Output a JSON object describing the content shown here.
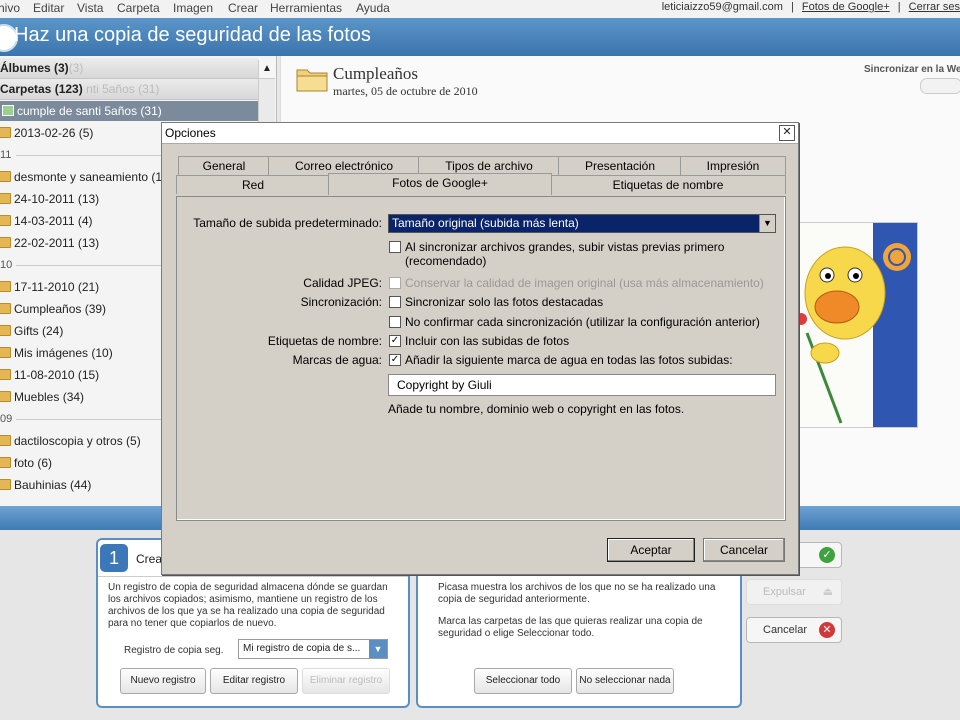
{
  "menubar": {
    "items": [
      "hivo",
      "Editar",
      "Vista",
      "Carpeta",
      "Imagen",
      "Crear",
      "Herramientas",
      "Ayuda"
    ],
    "user_email": "leticiaizzo59@gmail.com",
    "google_photos_link": "Fotos de Google+",
    "logout_link": "Cerrar ses",
    "sep": "|"
  },
  "title": "Haz una copia de seguridad de las fotos",
  "left_panel": {
    "albums": "Álbumes (3)",
    "albums_ghost": "(3)",
    "folders": "Carpetas (123)",
    "folders_ghost": "nti 5años (31)",
    "selected": "cumple de santi 5años (31)",
    "rows": [
      {
        "type": "item",
        "label": "2013-02-26 (5)"
      },
      {
        "type": "year",
        "label": "11"
      },
      {
        "type": "item",
        "label": "desmonte y saneamiento (1"
      },
      {
        "type": "item",
        "label": "24-10-2011 (13)"
      },
      {
        "type": "item",
        "label": "14-03-2011 (4)"
      },
      {
        "type": "item",
        "label": "22-02-2011 (13)"
      },
      {
        "type": "year",
        "label": "10"
      },
      {
        "type": "item",
        "label": "17-11-2010 (21)"
      },
      {
        "type": "item",
        "label": "Cumpleaños (39)"
      },
      {
        "type": "item",
        "label": "Gifts (24)"
      },
      {
        "type": "item",
        "label": "Mis imágenes (10)"
      },
      {
        "type": "item",
        "label": "11-08-2010 (15)"
      },
      {
        "type": "item",
        "label": "Muebles (34)"
      },
      {
        "type": "year",
        "label": "09"
      },
      {
        "type": "item",
        "label": "dactiloscopia y otros (5)"
      },
      {
        "type": "item",
        "label": "foto (6)"
      },
      {
        "type": "item",
        "label": "Bauhinias (44)"
      }
    ]
  },
  "main": {
    "folder_title": "Cumpleaños",
    "folder_date": "martes, 05 de octubre de 2010",
    "sync_web": "Sincronizar en la Web"
  },
  "bottom": {
    "step1_number": "1",
    "step1_title": "Crea",
    "step1_desc": "Un registro de copia de seguridad almacena dónde se guardan los archivos copiados; asimismo, mantiene un registro de los archivos de los que ya se ha realizado una copia de seguridad para no tener que copiarlos de nuevo.",
    "backup_log_label": "Registro de copia seg.",
    "backup_log_value": "Mi registro de copia de s...",
    "new_log": "Nuevo registro",
    "edit_log": "Editar registro",
    "delete_log": "Eliminar registro",
    "step2_desc1": "Picasa muestra los archivos de los que no se ha realizado una copia de seguridad anteriormente.",
    "step2_desc2": "Marca las carpetas de las que quieras realizar una copia de seguridad o elige Seleccionar todo.",
    "select_all": "Seleccionar todo",
    "select_none": "No seleccionar nada",
    "eject": "Expulsar",
    "cancel": "Cancelar"
  },
  "dialog": {
    "title": "Opciones",
    "close": "✕",
    "tabs_back": [
      "General",
      "Correo electrónico",
      "Tipos de archivo",
      "Presentación",
      "Impresión"
    ],
    "tabs_front": [
      "Red",
      "Fotos de Google+",
      "Etiquetas de nombre"
    ],
    "upload_size_label": "Tamaño de subida predeterminado:",
    "upload_size_value": "Tamaño original (subida más lenta)",
    "preview_first": "Al sincronizar archivos grandes, subir vistas previas primero",
    "preview_first_2": "(recomendado)",
    "jpeg_label": "Calidad JPEG:",
    "jpeg_option": "Conservar la calidad de imagen original (usa más almacenamiento)",
    "sync_label": "Sincronización:",
    "sync_starred": "Sincronizar solo las fotos destacadas",
    "no_confirm": "No confirmar cada sincronización (utilizar la configuración anterior)",
    "name_tags_label": "Etiquetas de nombre:",
    "include_uploads": "Incluir con las subidas de fotos",
    "watermark_label": "Marcas de agua:",
    "add_watermark": "Añadir la siguiente marca de agua en todas las fotos subidas:",
    "watermark_value": "Copyright by Giuli",
    "watermark_hint": "Añade tu nombre, dominio web o copyright en las fotos.",
    "accept": "Aceptar",
    "cancel": "Cancelar",
    "checked_mark": "✓"
  }
}
